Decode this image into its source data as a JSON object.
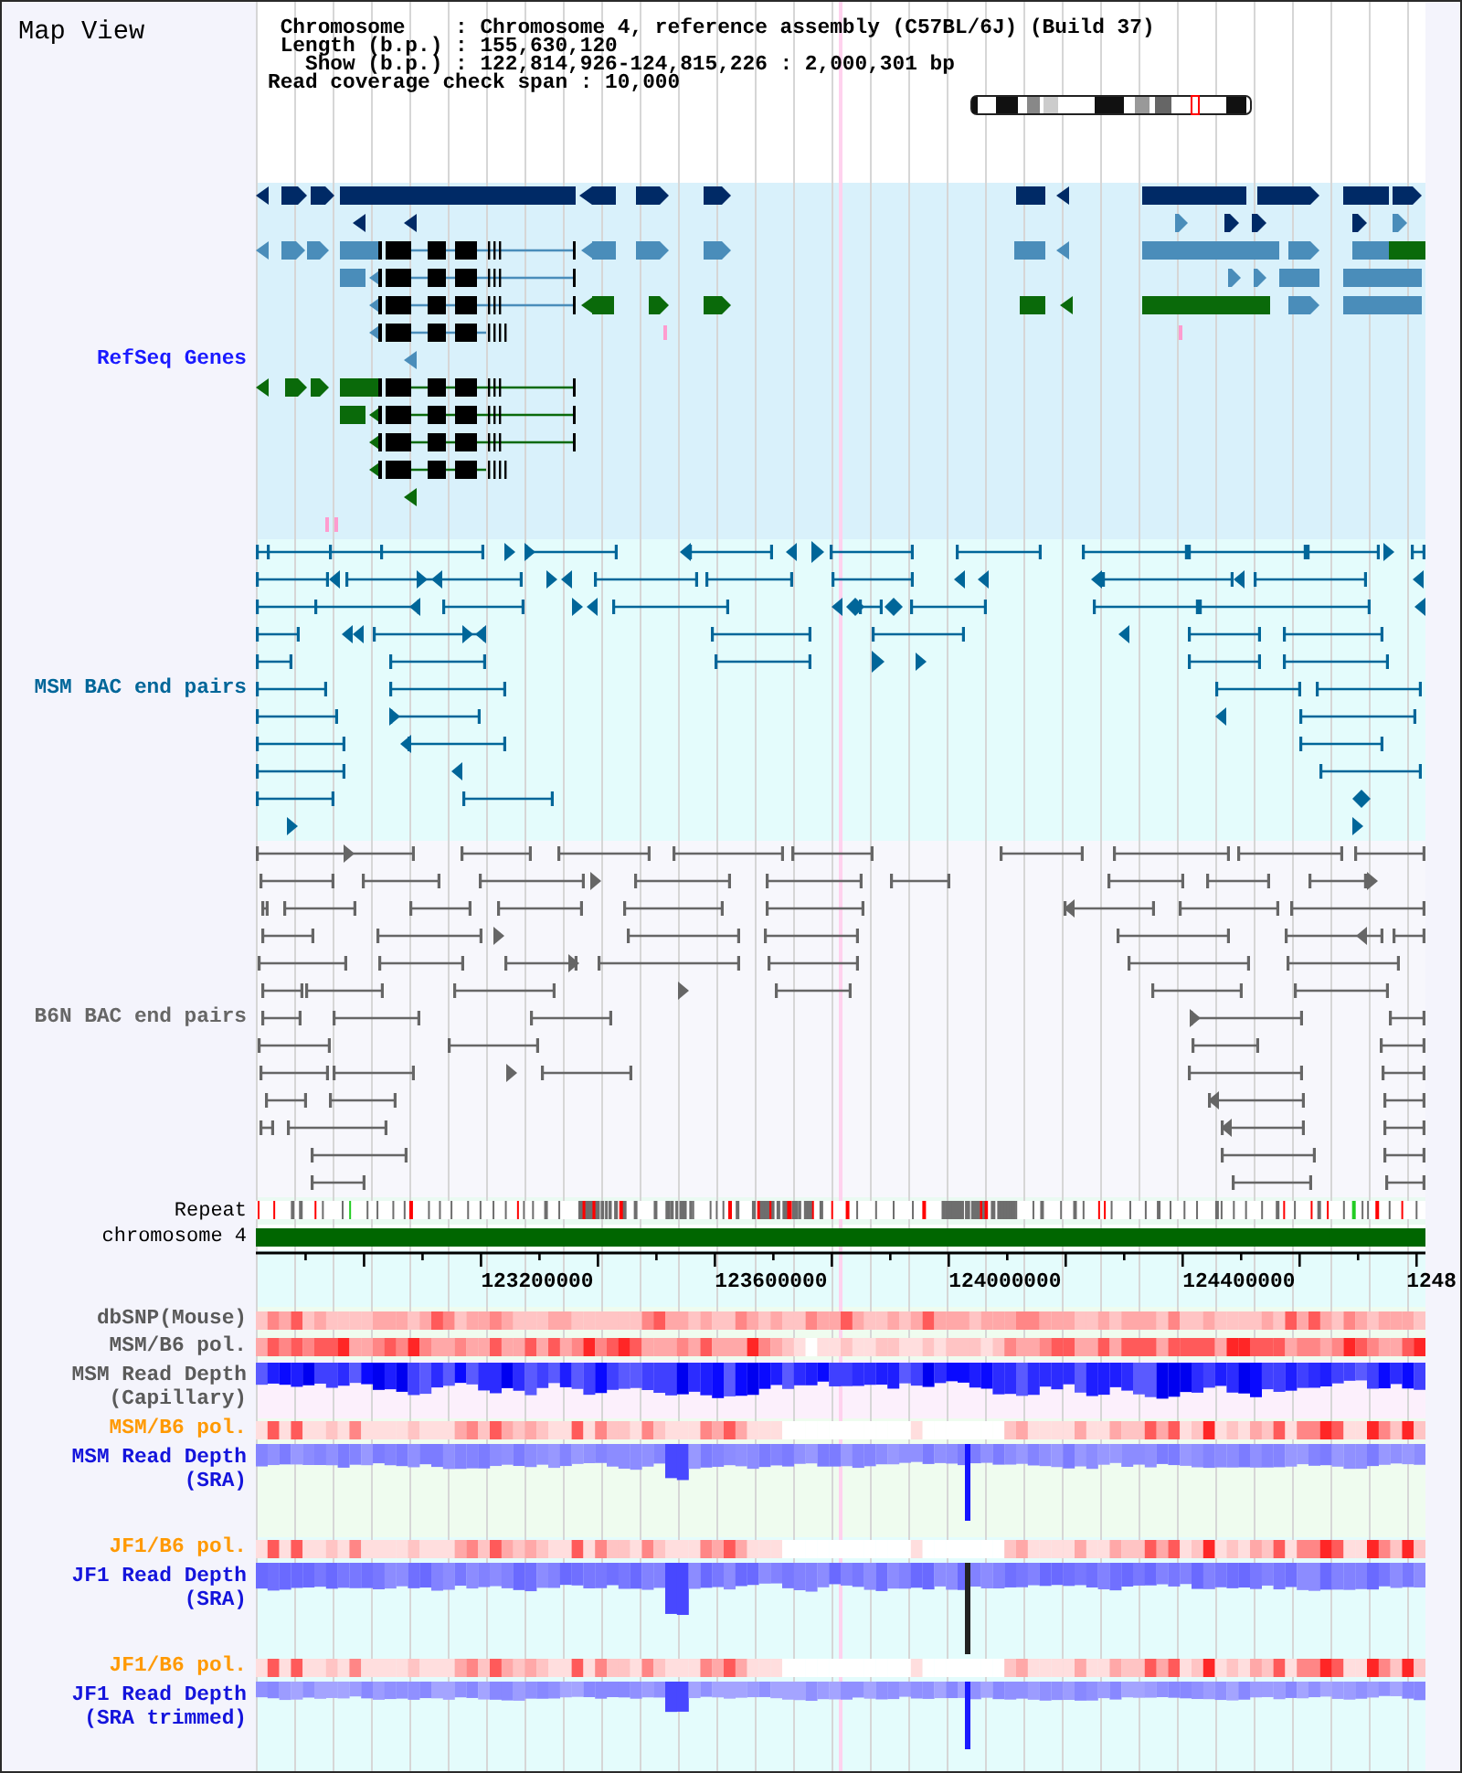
{
  "title": "Map View",
  "header": {
    "lines": [
      "Chromosome    : Chromosome 4, reference assembly (C57BL/6J) (Build 37)",
      "Length (b.p.) : 155,630,120",
      "Show (b.p.) : 122,814,926-124,815,226 : 2,000,301 bp",
      "Read coverage check span : 10,000"
    ]
  },
  "feature_tracks": [
    {
      "label": "RefSeq Genes",
      "kind": "genes",
      "color": "#1a1aff"
    },
    {
      "label": "MSM BAC end pairs",
      "kind": "pairs",
      "color": "#006699"
    },
    {
      "label": "B6N BAC end pairs",
      "kind": "pairs",
      "color": "#666666"
    }
  ],
  "repeat_track": {
    "label": "Repeat"
  },
  "chromosome_track": {
    "label": "chromosome 4"
  },
  "axis": {
    "ticks": [
      "123200000",
      "123600000",
      "124000000",
      "124400000",
      "1248"
    ]
  },
  "data_tracks": [
    {
      "label": [
        "dbSNP(Mouse)"
      ],
      "kind": "heat",
      "color": "#5a5a5a"
    },
    {
      "label": [
        "MSM/B6 pol."
      ],
      "kind": "heat",
      "color": "#5a5a5a"
    },
    {
      "label": [
        "MSM Read Depth",
        "(Capillary)"
      ],
      "kind": "depth",
      "color": "#5a5a5a"
    },
    {
      "label": [
        "MSM/B6 pol."
      ],
      "kind": "heat",
      "color": "#ff9900"
    },
    {
      "label": [
        "MSM Read Depth",
        "(SRA)"
      ],
      "kind": "depth",
      "color": "#1414dc"
    },
    {
      "label": [
        "JF1/B6 pol."
      ],
      "kind": "heat",
      "color": "#ff9900"
    },
    {
      "label": [
        "JF1 Read Depth",
        "(SRA)"
      ],
      "kind": "depth",
      "color": "#1414dc"
    },
    {
      "label": [
        "JF1/B6 pol."
      ],
      "kind": "heat",
      "color": "#ff9900"
    },
    {
      "label": [
        "JF1 Read Depth",
        "(SRA trimmed)"
      ],
      "kind": "depth",
      "color": "#1414dc"
    }
  ]
}
